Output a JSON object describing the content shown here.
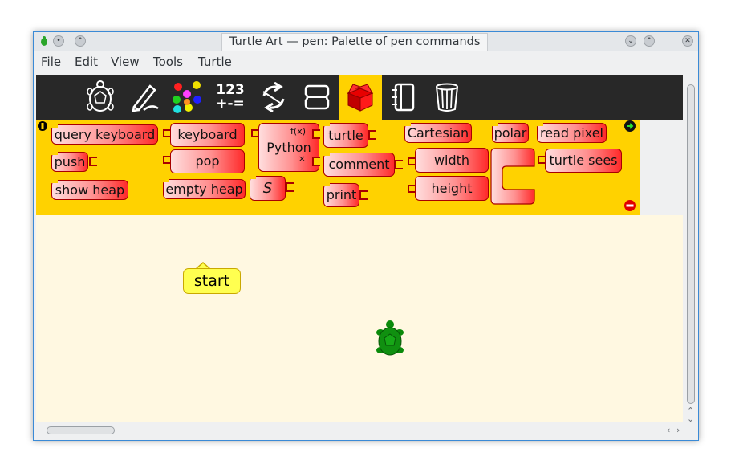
{
  "window": {
    "title": "Turtle Art — pen: Palette of pen commands"
  },
  "menubar": {
    "items": [
      "File",
      "Edit",
      "View",
      "Tools",
      "Turtle"
    ]
  },
  "toolbar": {
    "tools": [
      {
        "icon": "turtle-icon",
        "active": false
      },
      {
        "icon": "pen-icon",
        "active": false
      },
      {
        "icon": "colors-icon",
        "active": false
      },
      {
        "icon": "numbers-icon",
        "label_top": "123",
        "label_bottom": "+-=",
        "active": false
      },
      {
        "icon": "flow-icon",
        "active": false
      },
      {
        "icon": "blocks-icon",
        "active": false
      },
      {
        "icon": "extras-icon",
        "active": true
      },
      {
        "icon": "notebook-icon",
        "active": false
      },
      {
        "icon": "trash-icon",
        "active": false
      }
    ],
    "active_color": "#ffd200"
  },
  "palette": {
    "blocks": {
      "query_keyboard": "query keyboard",
      "push": "push",
      "show_heap": "show heap",
      "keyboard": "keyboard",
      "pop": "pop",
      "empty_heap": "empty heap",
      "python": "Python",
      "python_fx": "f(x)",
      "python_x": "×",
      "turtle": "turtle",
      "comment": "comment",
      "print": "print",
      "cartesian": "Cartesian",
      "width": "width",
      "height": "height",
      "polar": "polar",
      "read_pixel": "read pixel",
      "turtle_sees": "turtle sees"
    },
    "background": "#ffd200",
    "block_color": "#ff3030"
  },
  "canvas": {
    "start_label": "start",
    "background": "#fff8e1"
  }
}
